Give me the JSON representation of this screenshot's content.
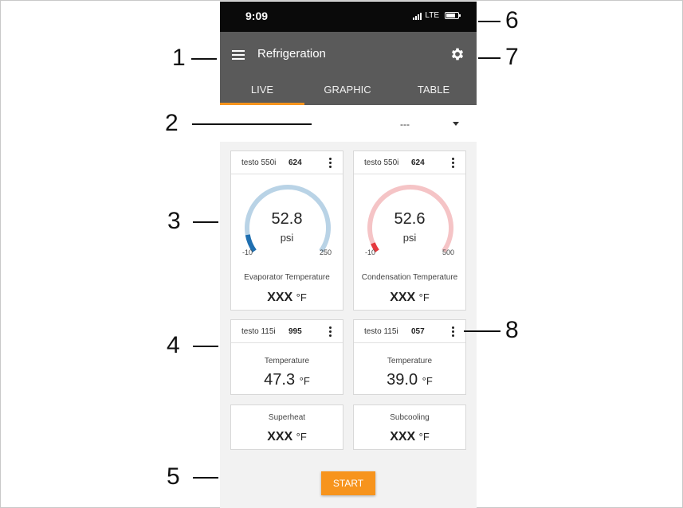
{
  "status": {
    "time": "9:09",
    "network": "LTE"
  },
  "appbar": {
    "title": "Refrigeration",
    "menu_icon": "menu-icon",
    "settings_icon": "gear-icon"
  },
  "tabs": [
    {
      "label": "LIVE",
      "active": true
    },
    {
      "label": "GRAPHIC",
      "active": false
    },
    {
      "label": "TABLE",
      "active": false
    }
  ],
  "selector": {
    "value": "---"
  },
  "cards": {
    "p1": {
      "probe": "testo 550i",
      "serial": "624",
      "value": "52.8",
      "unit": "psi",
      "min": "-10",
      "max": "250",
      "label": "Evaporator Temperature",
      "reading": "XXX",
      "reading_unit": "°F",
      "color": "#1f6fb0",
      "track": "#b9d3e6",
      "fill": 0.1
    },
    "p2": {
      "probe": "testo 550i",
      "serial": "624",
      "value": "52.6",
      "unit": "psi",
      "min": "-10",
      "max": "500",
      "label": "Condensation Temperature",
      "reading": "XXX",
      "reading_unit": "°F",
      "color": "#e5383e",
      "track": "#f5c4c6",
      "fill": 0.05
    },
    "t1": {
      "probe": "testo 115i",
      "serial": "995",
      "label": "Temperature",
      "value": "47.3",
      "unit": "°F"
    },
    "t2": {
      "probe": "testo 115i",
      "serial": "057",
      "label": "Temperature",
      "value": "39.0",
      "unit": "°F"
    },
    "sh": {
      "label": "Superheat",
      "value": "XXX",
      "unit": "°F"
    },
    "sc": {
      "label": "Subcooling",
      "value": "XXX",
      "unit": "°F"
    }
  },
  "start_label": "START",
  "callouts": [
    "1",
    "2",
    "3",
    "4",
    "5",
    "6",
    "7",
    "8"
  ],
  "colors": {
    "accent": "#f7941d",
    "appbar": "#5a5a5a"
  }
}
